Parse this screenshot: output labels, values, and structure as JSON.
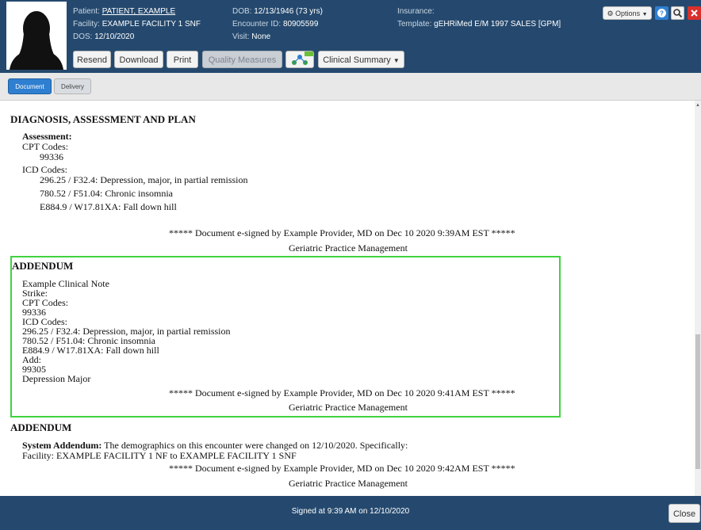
{
  "patient": {
    "patient_label": "Patient:",
    "patient_value": "PATIENT, EXAMPLE",
    "facility_label": "Facility:",
    "facility_value": "EXAMPLE FACILITY 1 SNF",
    "dos_label": "DOS:",
    "dos_value": "12/10/2020",
    "dob_label": "DOB:",
    "dob_value": "12/13/1946 (73 yrs)",
    "encounter_label": "Encounter ID:",
    "encounter_value": "80905599",
    "visit_label": "Visit:",
    "visit_value": "None",
    "insurance_label": "Insurance:",
    "template_label": "Template:",
    "template_value": "gEHRiMed E/M 1997 SALES [GPM]"
  },
  "toolbar": {
    "resend": "Resend",
    "download": "Download",
    "print": "Print",
    "quality": "Quality Measures",
    "clinical_summary": "Clinical Summary"
  },
  "topright": {
    "options": "Options"
  },
  "tabs": {
    "document": "Document",
    "delivery": "Delivery"
  },
  "doc": {
    "section_title": "DIAGNOSIS, ASSESSMENT AND PLAN",
    "assessment_label": "Assessment:",
    "cpt_label": "CPT Codes:",
    "cpt_code": "99336",
    "icd_label": "ICD Codes:",
    "icd_codes": [
      "296.25 / F32.4: Depression, major, in partial remission",
      "780.52 / F51.04: Chronic insomnia",
      "E884.9 / W17.81XA: Fall down hill"
    ],
    "signature1": "***** Document e-signed by Example Provider, MD on Dec 10 2020  9:39AM EST *****",
    "org": "Geriatric Practice Management",
    "addendum_title": "ADDENDUM",
    "addendum_lines": [
      "Example Clinical Note",
      "Strike:",
      "CPT Codes:",
      "99336",
      "ICD Codes:",
      "296.25 / F32.4: Depression, major, in partial remission",
      "780.52 / F51.04: Chronic insomnia",
      "E884.9 / W17.81XA: Fall down hill",
      "Add:",
      "99305",
      "Depression Major"
    ],
    "signature2": "***** Document e-signed by Example Provider, MD on Dec 10 2020  9:41AM EST *****",
    "addendum2_title": "ADDENDUM",
    "system_addendum_label": "System Addendum:",
    "system_addendum_text": "The demographics on this encounter were changed on 12/10/2020. Specifically:",
    "facility_change": "Facility: EXAMPLE FACILITY 1 NF to EXAMPLE FACILITY 1 SNF",
    "signature3": "***** Document e-signed by Example Provider, MD on Dec 10 2020  9:42AM EST *****"
  },
  "footer": {
    "signed_text": "Signed at 9:39 AM on 12/10/2020",
    "close": "Close"
  },
  "colors": {
    "header_bg": "#25496e",
    "accent_blue": "#2f7fd1",
    "highlight_green": "#3fd33f",
    "red": "#d9302c"
  }
}
